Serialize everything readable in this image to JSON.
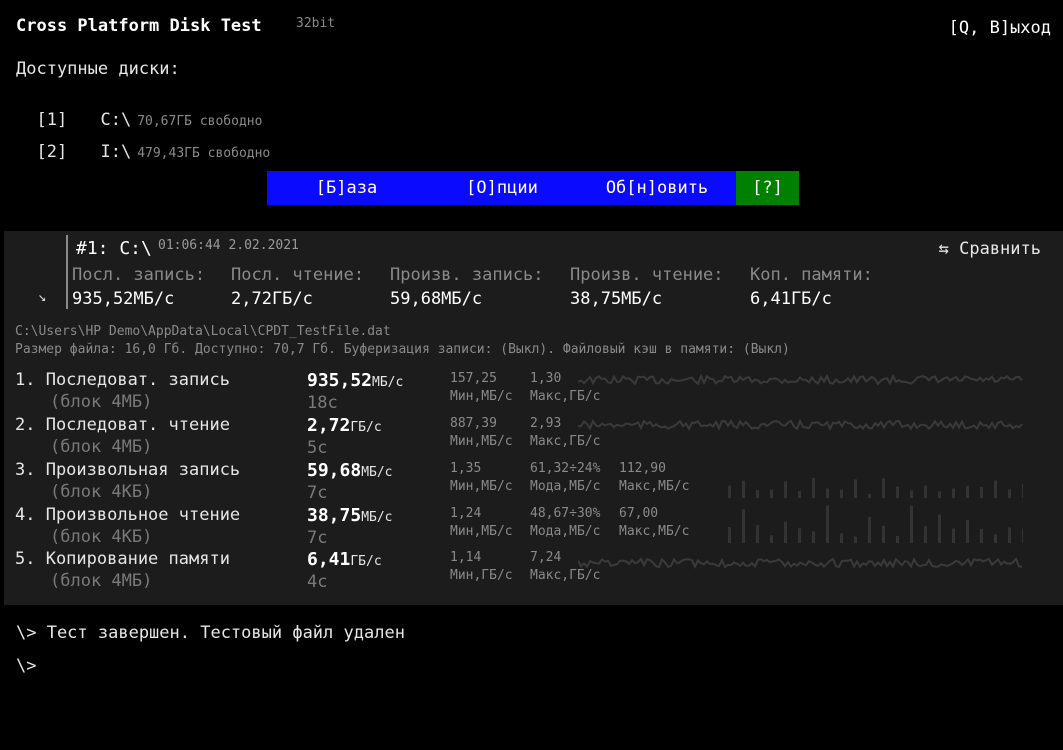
{
  "app": {
    "title": "Cross Platform Disk Test",
    "bits": "32bit",
    "quit": "[Q, В]ыход"
  },
  "disks": {
    "label": "Доступные диски:",
    "items": [
      {
        "key": "[1]",
        "path": "C:\\",
        "free": "70,67ГБ свободно"
      },
      {
        "key": "[2]",
        "path": "I:\\",
        "free": "479,43ГБ свободно"
      }
    ]
  },
  "menu": {
    "db": "[Б]аза",
    "options": "[О]пции",
    "refresh": "Об[н]овить",
    "help": "[?]",
    "colors": {
      "blue": "#0a0aff",
      "green": "#008000"
    }
  },
  "result": {
    "run": "#1: C:\\",
    "datetime": "01:06:44 2.02.2021",
    "compare": "⇆ Сравнить",
    "arrow": "↘",
    "summary": [
      {
        "label": "Посл. запись:",
        "value": "935,52МБ/с"
      },
      {
        "label": "Посл. чтение:",
        "value": "2,72ГБ/с"
      },
      {
        "label": "Произв. запись:",
        "value": "59,68МБ/с"
      },
      {
        "label": "Произв. чтение:",
        "value": "38,75МБ/с"
      },
      {
        "label": "Коп. памяти:",
        "value": "6,41ГБ/с"
      }
    ]
  },
  "file": {
    "path": "C:\\Users\\HP Demo\\AppData\\Local\\CPDT_TestFile.dat",
    "info": "Размер файла: 16,0 Гб. Доступно: 70,7 Гб. Буферизация записи: (Выкл). Файловый кэш в памяти: (Выкл)"
  },
  "tests": [
    {
      "name": "1. Последоват. запись",
      "block": "(блок 4МБ)",
      "value": "935,52",
      "unit": "МБ/с",
      "time": "18с",
      "stats": [
        {
          "top": "157,25",
          "bottom": "Мин,МБ/с"
        },
        {
          "top": "1,30",
          "bottom": "Макс,ГБ/с"
        }
      ]
    },
    {
      "name": "2. Последоват. чтение",
      "block": "(блок 4МБ)",
      "value": "2,72",
      "unit": "ГБ/с",
      "time": "5с",
      "stats": [
        {
          "top": "887,39",
          "bottom": "Мин,МБ/с"
        },
        {
          "top": "2,93",
          "bottom": "Макс,ГБ/с"
        }
      ]
    },
    {
      "name": "3. Произвольная запись",
      "block": "(блок 4КБ)",
      "value": "59,68",
      "unit": "МБ/с",
      "time": "7с",
      "stats": [
        {
          "top": "1,35",
          "bottom": "Мин,МБ/с"
        },
        {
          "top": "61,32÷24%",
          "bottom": "Мода,МБ/с"
        },
        {
          "top": "112,90",
          "bottom": "Макс,МБ/с"
        }
      ]
    },
    {
      "name": "4. Произвольное чтение",
      "block": "(блок 4КБ)",
      "value": "38,75",
      "unit": "МБ/с",
      "time": "7с",
      "stats": [
        {
          "top": "1,24",
          "bottom": "Мин,МБ/с"
        },
        {
          "top": "48,67÷30%",
          "bottom": "Мода,МБ/с"
        },
        {
          "top": "67,00",
          "bottom": "Макс,МБ/с"
        }
      ]
    },
    {
      "name": "5. Копирование памяти",
      "block": "(блок 4МБ)",
      "value": "6,41",
      "unit": "ГБ/с",
      "time": "4с",
      "stats": [
        {
          "top": "1,14",
          "bottom": "Мин,ГБ/с"
        },
        {
          "top": "7,24",
          "bottom": "Макс,ГБ/с"
        }
      ]
    }
  ],
  "console": {
    "log": "\\> Тест завершен. Тестовый файл удален",
    "prompt": "\\>"
  }
}
